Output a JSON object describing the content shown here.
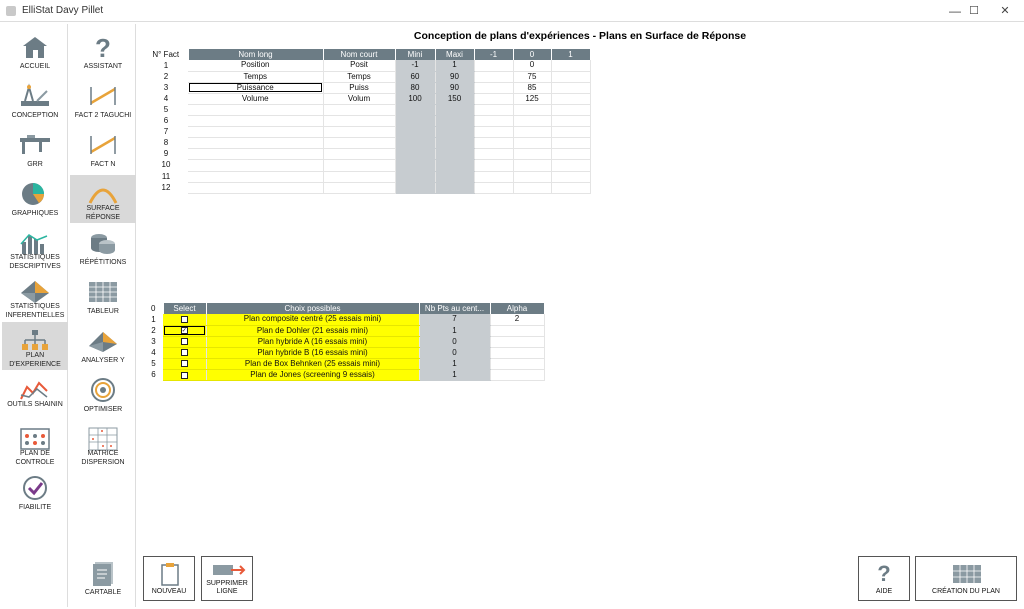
{
  "window": {
    "title": "ElliStat Davy Pillet",
    "minimize": "—",
    "maximize": "☐",
    "close": "✕"
  },
  "nav_left": [
    {
      "label": "ACCUEIL",
      "icon": "home-icon"
    },
    {
      "label": "CONCEPTION",
      "icon": "conception-icon"
    },
    {
      "label": "GRR",
      "icon": "caliper-icon"
    },
    {
      "label": "GRAPHIQUES",
      "icon": "pie-chart-icon"
    },
    {
      "label": "STATISTIQUES DESCRIPTIVES",
      "icon": "bar-chart-icon"
    },
    {
      "label": "STATISTIQUES INFERENTIELLES",
      "icon": "pyramid-icon"
    },
    {
      "label": "PLAN D'EXPERIENCE",
      "icon": "tree-icon"
    },
    {
      "label": "OUTILS SHAININ",
      "icon": "line-chart-icon"
    },
    {
      "label": "PLAN DE CONTROLE",
      "icon": "control-plan-icon"
    },
    {
      "label": "FIABILITE",
      "icon": "check-icon"
    }
  ],
  "nav_right": [
    {
      "label": "ASSISTANT",
      "icon": "question-icon"
    },
    {
      "label": "FACT 2 TAGUCHI",
      "icon": "taguchi-icon"
    },
    {
      "label": "FACT N",
      "icon": "fact-n-icon"
    },
    {
      "label": "SURFACE RÉPONSE",
      "icon": "surface-icon"
    },
    {
      "label": "RÉPÉTITIONS",
      "icon": "cylinders-icon"
    },
    {
      "label": "TABLEUR",
      "icon": "spreadsheet-icon"
    },
    {
      "label": "ANALYSER Y",
      "icon": "surface-3d-icon"
    },
    {
      "label": "OPTIMISER",
      "icon": "target-icon"
    },
    {
      "label": "MATRICE DISPERSION",
      "icon": "matrix-icon"
    },
    {
      "label": "CARTABLE",
      "icon": "binder-icon"
    }
  ],
  "heading": "Conception de plans d'expériences - Plans en Surface de Réponse",
  "factors": {
    "headers": [
      "N° Fact",
      "Nom long",
      "Nom court",
      "Mini",
      "Maxi",
      "-1",
      "0",
      "1"
    ],
    "rows": [
      [
        "1",
        "Position",
        "Posit",
        "-1",
        "1",
        "",
        "0",
        ""
      ],
      [
        "2",
        "Temps",
        "Temps",
        "60",
        "90",
        "",
        "75",
        ""
      ],
      [
        "3",
        "Puissance",
        "Puiss",
        "80",
        "90",
        "",
        "85",
        ""
      ],
      [
        "4",
        "Volume",
        "Volum",
        "100",
        "150",
        "",
        "125",
        ""
      ],
      [
        "5",
        "",
        "",
        "",
        "",
        "",
        "",
        ""
      ],
      [
        "6",
        "",
        "",
        "",
        "",
        "",
        "",
        ""
      ],
      [
        "7",
        "",
        "",
        "",
        "",
        "",
        "",
        ""
      ],
      [
        "8",
        "",
        "",
        "",
        "",
        "",
        "",
        ""
      ],
      [
        "9",
        "",
        "",
        "",
        "",
        "",
        "",
        ""
      ],
      [
        "10",
        "",
        "",
        "",
        "",
        "",
        "",
        ""
      ],
      [
        "11",
        "",
        "",
        "",
        "",
        "",
        "",
        ""
      ],
      [
        "12",
        "",
        "",
        "",
        "",
        "",
        "",
        ""
      ]
    ]
  },
  "plans": {
    "headers": [
      "0",
      "Select",
      "Choix possibles",
      "Nb Pts au cent...",
      "Alpha"
    ],
    "rows": [
      {
        "n": "1",
        "checked": false,
        "choice": "Plan composite centré (25 essais mini)",
        "pts": "7",
        "alpha": "2"
      },
      {
        "n": "2",
        "checked": true,
        "choice": "Plan de Dohler (21 essais mini)",
        "pts": "1",
        "alpha": ""
      },
      {
        "n": "3",
        "checked": false,
        "choice": "Plan hybride A (16 essais mini)",
        "pts": "0",
        "alpha": ""
      },
      {
        "n": "4",
        "checked": false,
        "choice": "Plan hybride B (16 essais mini)",
        "pts": "0",
        "alpha": ""
      },
      {
        "n": "5",
        "checked": false,
        "choice": "Plan de Box Behnken (25 essais mini)",
        "pts": "1",
        "alpha": ""
      },
      {
        "n": "6",
        "checked": false,
        "choice": "Plan de Jones (screening 9 essais)",
        "pts": "1",
        "alpha": ""
      }
    ]
  },
  "bottom": {
    "nouveau": "NOUVEAU",
    "supprimer": "SUPPRIMER LIGNE",
    "aide": "AIDE",
    "creation": "CRÉATION DU PLAN",
    "question_mark": "?"
  },
  "colors": {
    "header": "#6c7c85",
    "highlight": "#ffff00",
    "grey": "#c7ccd0",
    "accent": "#e8a33a"
  }
}
